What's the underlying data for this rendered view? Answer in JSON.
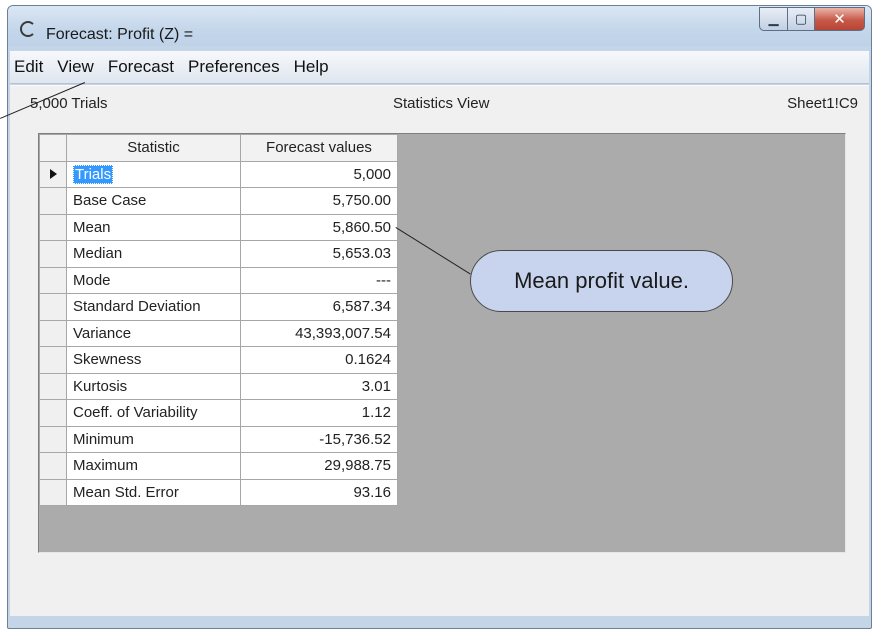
{
  "window": {
    "title": "Forecast: Profit (Z) =",
    "min_glyph": "▁",
    "max_glyph": "▢",
    "close_glyph": "✕"
  },
  "menu": [
    "Edit",
    "View",
    "Forecast",
    "Preferences",
    "Help"
  ],
  "status": {
    "left": "5,000 Trials",
    "center": "Statistics View",
    "right": "Sheet1!C9"
  },
  "table": {
    "headers": [
      "Statistic",
      "Forecast values"
    ],
    "rows": [
      {
        "stat": "Trials",
        "value": "5,000"
      },
      {
        "stat": "Base Case",
        "value": "5,750.00"
      },
      {
        "stat": "Mean",
        "value": "5,860.50"
      },
      {
        "stat": "Median",
        "value": "5,653.03"
      },
      {
        "stat": "Mode",
        "value": "---"
      },
      {
        "stat": "Standard Deviation",
        "value": "6,587.34"
      },
      {
        "stat": "Variance",
        "value": "43,393,007.54"
      },
      {
        "stat": "Skewness",
        "value": "0.1624"
      },
      {
        "stat": "Kurtosis",
        "value": "3.01"
      },
      {
        "stat": "Coeff. of Variability",
        "value": "1.12"
      },
      {
        "stat": "Minimum",
        "value": "-15,736.52"
      },
      {
        "stat": "Maximum",
        "value": "29,988.75"
      },
      {
        "stat": "Mean Std. Error",
        "value": "93.16"
      }
    ]
  },
  "callout": {
    "text": "Mean profit value."
  },
  "colors": {
    "frame": "#c5d5e8",
    "selection": "#3399ff",
    "callout_fill": "#c8d4ee"
  }
}
